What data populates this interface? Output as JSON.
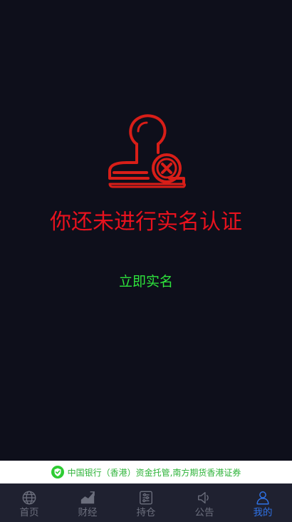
{
  "main": {
    "title": "你还未进行实名认证",
    "verify_button": "立即实名"
  },
  "notice": {
    "text": "中国银行（香港）资金托管,南方期货香港证券"
  },
  "tabs": [
    {
      "label": "首页",
      "icon": "globe-icon"
    },
    {
      "label": "财经",
      "icon": "chart-icon"
    },
    {
      "label": "持仓",
      "icon": "sliders-icon"
    },
    {
      "label": "公告",
      "icon": "speaker-icon"
    },
    {
      "label": "我的",
      "icon": "user-icon",
      "active": true
    }
  ],
  "colors": {
    "background": "#0e0f1b",
    "title": "#e8121e",
    "button": "#2ee33c",
    "tab_active": "#2f72e6",
    "tab_inactive": "#6b6e7c",
    "notice_text": "#2fb43a"
  }
}
